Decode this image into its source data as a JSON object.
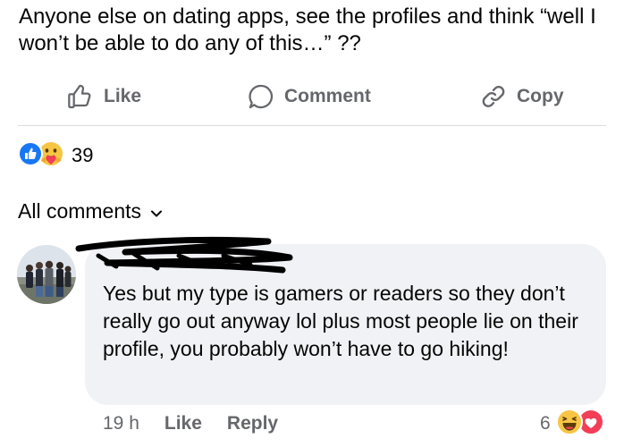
{
  "post": {
    "text": "Anyone else on dating apps, see the profiles and think “well I won’t be able to do any of this…” ??"
  },
  "actions": {
    "like": "Like",
    "comment": "Comment",
    "copy": "Copy"
  },
  "reactions": {
    "count": "39",
    "icons": [
      "like-reaction-icon",
      "care-reaction-icon"
    ]
  },
  "comments_header": {
    "label": "All comments"
  },
  "comment": {
    "text": "Yes but my type is gamers or readers so they don’t really go out anyway lol plus most people lie on their profile, you probably won’t have to go hiking!",
    "time": "19 h",
    "like": "Like",
    "reply": "Reply",
    "reaction_count": "6",
    "reaction_icons": [
      "haha-reaction-icon",
      "love-reaction-icon"
    ]
  },
  "colors": {
    "text": "#050505",
    "muted": "#65676b",
    "bubble": "#f0f2f5",
    "like_blue": "#1877f2",
    "love_red": "#f33e58",
    "emoji_yellow": "#f7c544"
  }
}
